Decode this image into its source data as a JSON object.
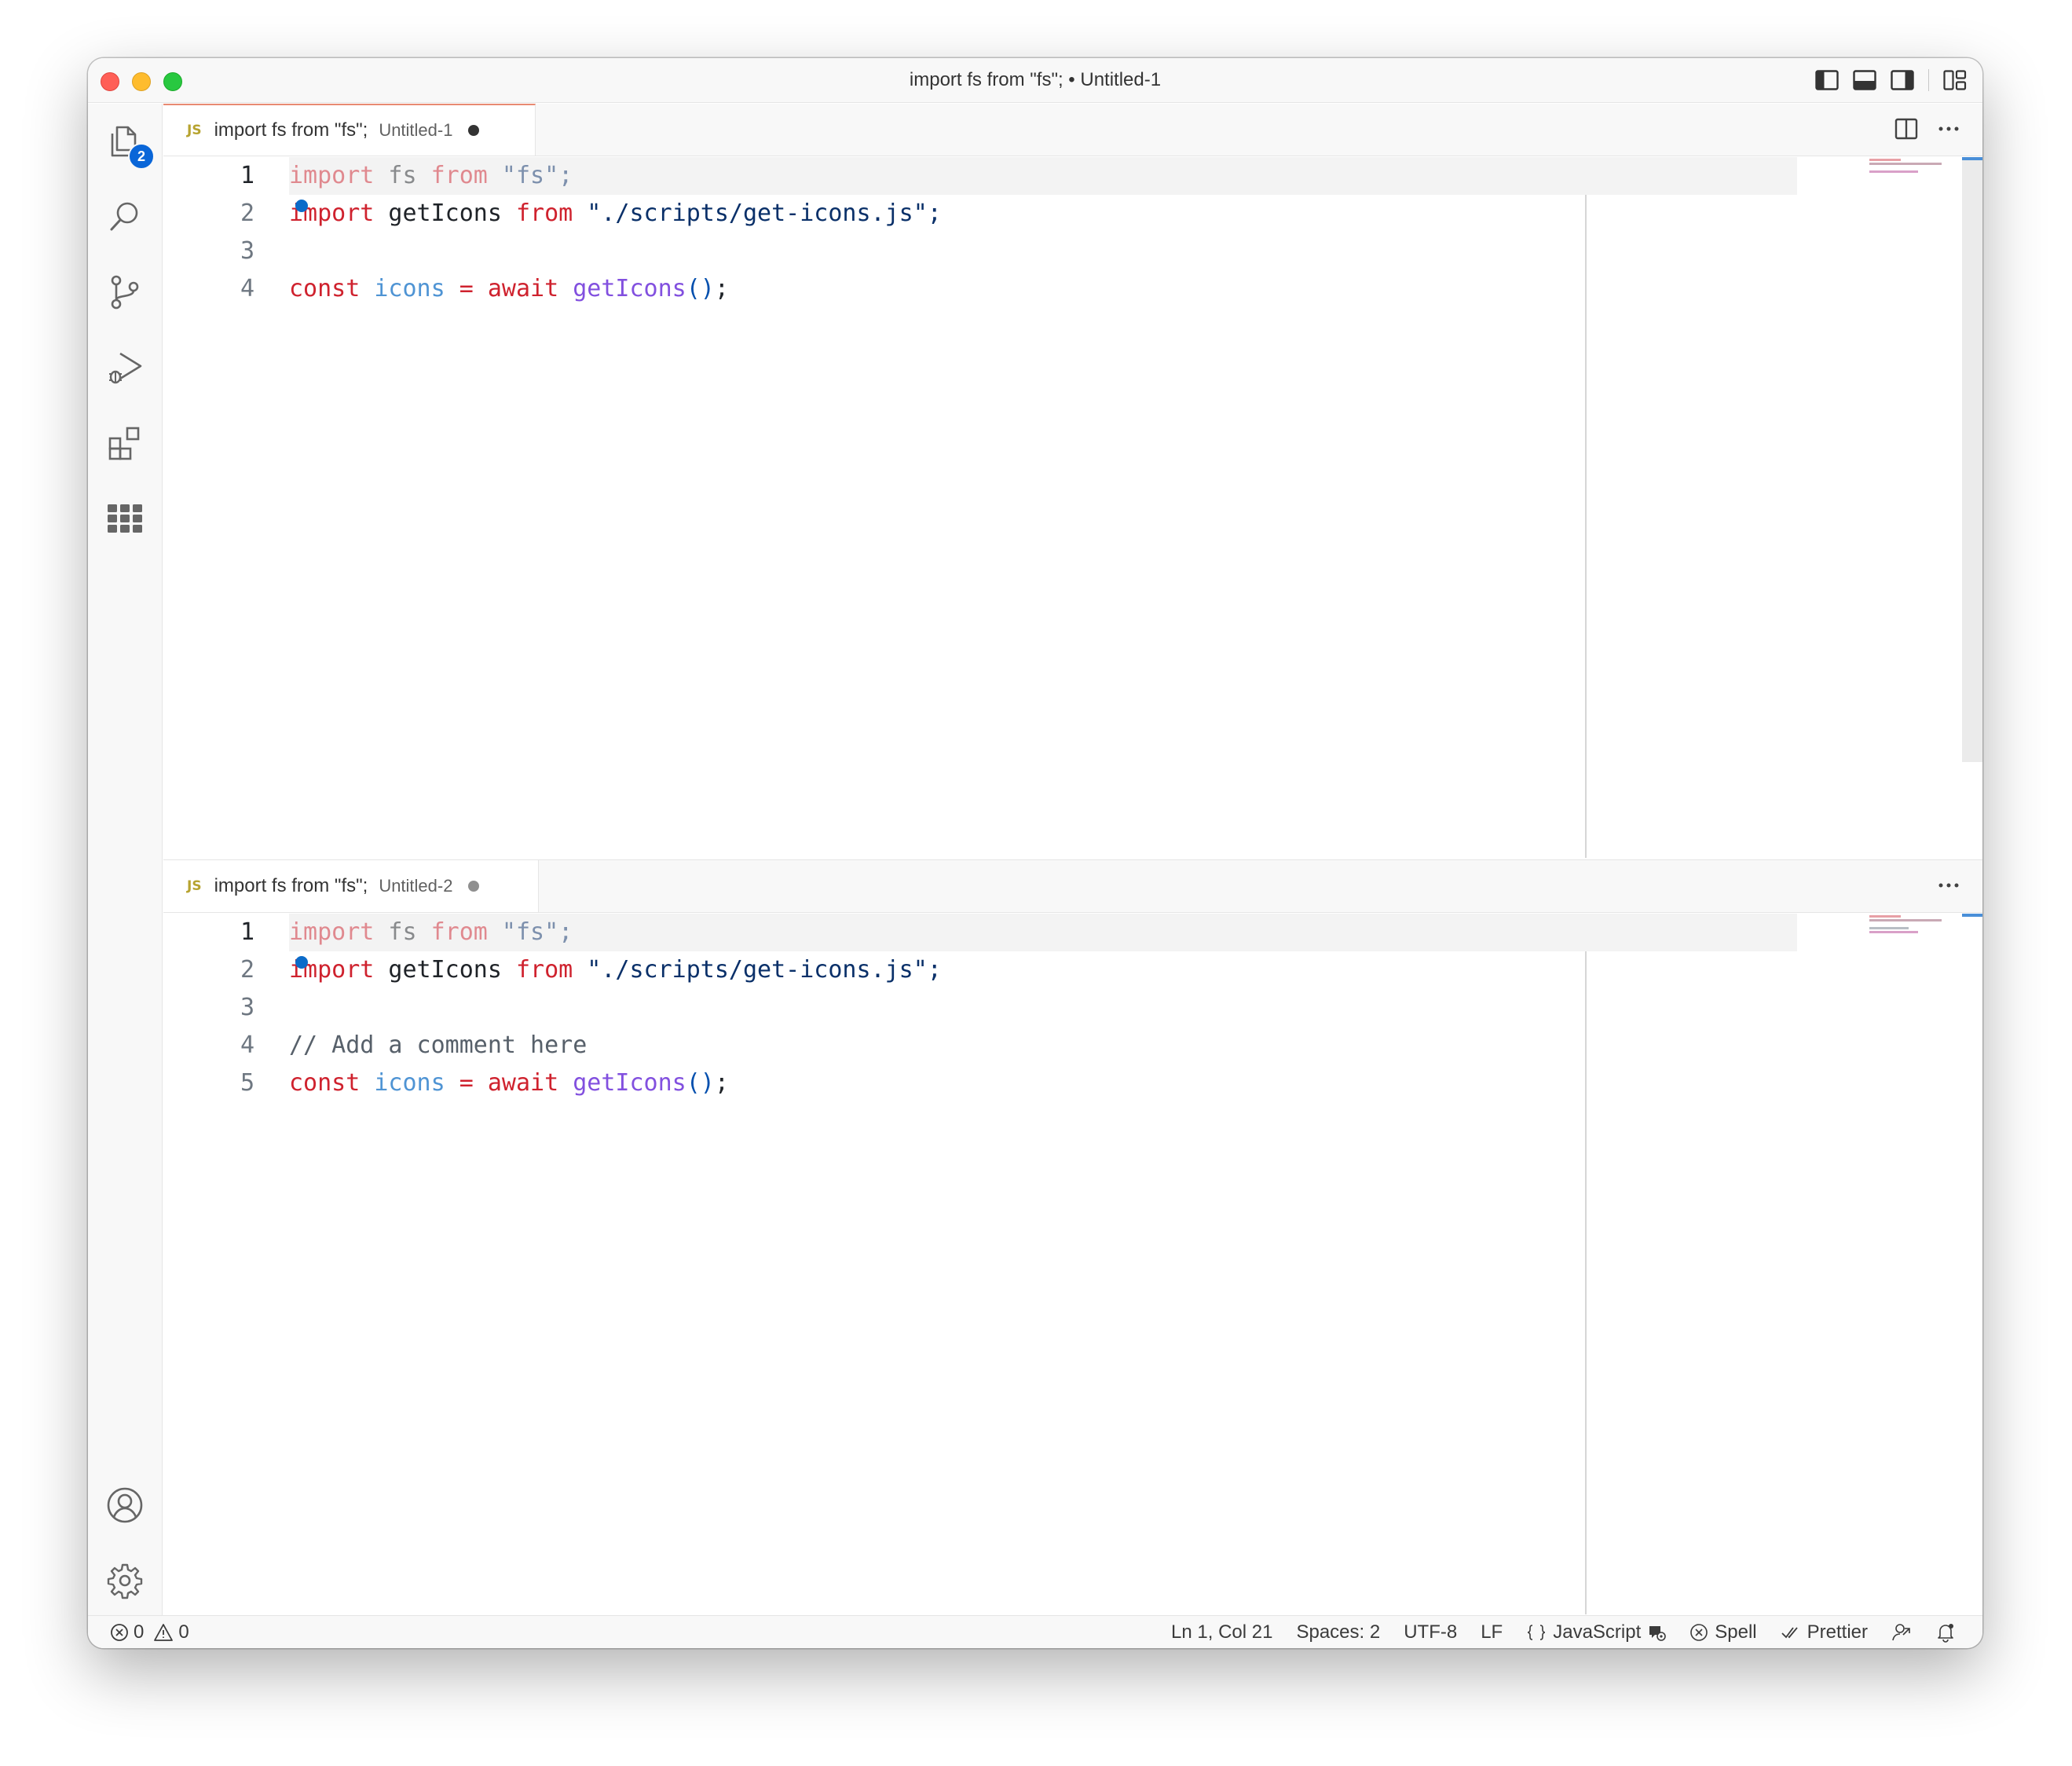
{
  "window": {
    "title": "import fs from \"fs\"; • Untitled-1"
  },
  "activity_bar": {
    "explorer_badge": "2"
  },
  "groups": [
    {
      "tab": {
        "lang": "JS",
        "label": "import fs from \"fs\";",
        "description": "Untitled-1",
        "dirty": true
      },
      "lines": [
        {
          "number": "1",
          "text": "import fs from \"fs\";"
        },
        {
          "number": "2",
          "text": "import getIcons from \"./scripts/get-icons.js\";"
        },
        {
          "number": "3",
          "text": ""
        },
        {
          "number": "4",
          "text": "const icons = await getIcons();"
        }
      ]
    },
    {
      "tab": {
        "lang": "JS",
        "label": "import fs from \"fs\";",
        "description": "Untitled-2",
        "dirty": true
      },
      "lines": [
        {
          "number": "1",
          "text": "import fs from \"fs\";"
        },
        {
          "number": "2",
          "text": "import getIcons from \"./scripts/get-icons.js\";"
        },
        {
          "number": "3",
          "text": ""
        },
        {
          "number": "4",
          "text": "// Add a comment here"
        },
        {
          "number": "5",
          "text": "const icons = await getIcons();"
        }
      ]
    }
  ],
  "code_tokens": {
    "import": "import",
    "fs": " fs ",
    "from": "from",
    "fs_str": " \"fs\";",
    "getIcons_import": " getIcons ",
    "path_str": " \"./scripts/get-icons.js\";",
    "const": "const",
    "icons": " icons",
    "eq": " = ",
    "await": "await",
    "call": " getIcons",
    "parens": "()",
    "semi": ";",
    "comment": "// Add a comment here"
  },
  "status_bar": {
    "errors": "0",
    "warnings": "0",
    "position": "Ln 1, Col 21",
    "spaces": "Spaces: 2",
    "encoding": "UTF-8",
    "eol": "LF",
    "language": "JavaScript",
    "spell": "Spell",
    "prettier": "Prettier"
  },
  "colors": {
    "keyword": "#cf222e",
    "string": "#0a3069",
    "variable": "#4f94d4",
    "function": "#8250df",
    "badge": "#0a66d8",
    "active_tab_border": "#e88a72"
  }
}
